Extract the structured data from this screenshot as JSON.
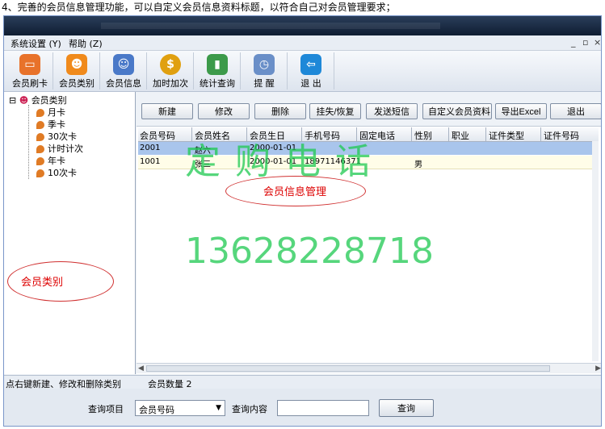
{
  "caption": "4、完善的会员信息管理功能，可以自定义会员信息资料标题，以符合自己对会员管理要求；",
  "menu": {
    "system": "系统设置 (Y)",
    "help": "帮助 (Z)"
  },
  "window_controls": {
    "minimize": "_",
    "restore": "▫",
    "close": "×"
  },
  "toolbar": [
    {
      "label": "会员刷卡",
      "icon": "member-card-icon",
      "color": "#e8722a"
    },
    {
      "label": "会员类别",
      "icon": "member-category-icon",
      "color": "#f08a1c"
    },
    {
      "label": "会员信息",
      "icon": "member-info-icon",
      "color": "#4a79c8"
    },
    {
      "label": "加时加次",
      "icon": "dollar-coin-icon",
      "color": "#e0a010"
    },
    {
      "label": "统计查询",
      "icon": "statistics-icon",
      "color": "#3c9a4a"
    },
    {
      "label": "提 醒",
      "icon": "reminder-icon",
      "color": "#6a8fc8"
    },
    {
      "label": "退 出",
      "icon": "exit-icon",
      "color": "#1e88d8"
    }
  ],
  "tree": {
    "root": "会员类别",
    "items": [
      "月卡",
      "季卡",
      "30次卡",
      "计时计次",
      "年卡",
      "10次卡"
    ]
  },
  "annotations": {
    "left": "会员类别",
    "main": "会员信息管理"
  },
  "actions": [
    "新建",
    "修改",
    "删除",
    "挂失/恢复",
    "发送短信",
    "自定义会员资料",
    "导出Excel",
    "退出"
  ],
  "table": {
    "columns": [
      "会员号码",
      "会员姓名",
      "会员生日",
      "手机号码",
      "固定电话",
      "性别",
      "职业",
      "证件类型",
      "证件号码"
    ],
    "rows": [
      [
        "2001",
        "赵六",
        "2000-01-01",
        "",
        "",
        "",
        "",
        "",
        ""
      ],
      [
        "1001",
        "张三",
        "2000-01-01",
        "18971146371",
        "",
        "男",
        "",
        "",
        ""
      ]
    ]
  },
  "watermark": {
    "line1": "定购电话",
    "line2": "13628228718"
  },
  "status": {
    "hint": "点右键新建、修改和删除类别",
    "count": "会员数量 2"
  },
  "query": {
    "item_label": "查询项目",
    "item_value": "会员号码",
    "content_label": "查询内容",
    "content_value": "",
    "button": "查询"
  },
  "colors": {
    "accent": "#a9c5ec",
    "annotation": "#d00000",
    "watermark": "#1ec850"
  }
}
